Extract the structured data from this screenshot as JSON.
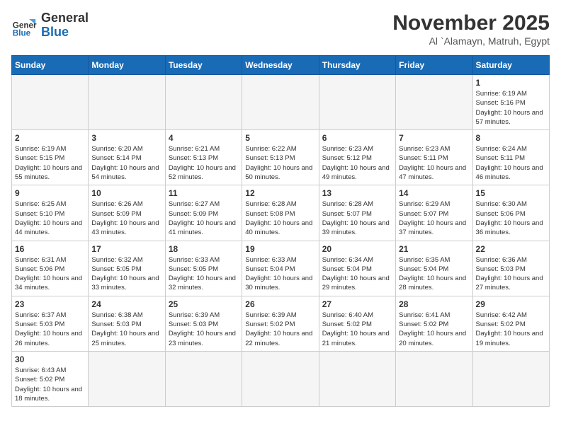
{
  "logo": {
    "text_general": "General",
    "text_blue": "Blue"
  },
  "header": {
    "month_year": "November 2025",
    "location": "Al `Alamayn, Matruh, Egypt"
  },
  "weekdays": [
    "Sunday",
    "Monday",
    "Tuesday",
    "Wednesday",
    "Thursday",
    "Friday",
    "Saturday"
  ],
  "days": {
    "d1": {
      "num": "1",
      "sunrise": "6:19 AM",
      "sunset": "5:16 PM",
      "daylight": "10 hours and 57 minutes."
    },
    "d2": {
      "num": "2",
      "sunrise": "6:19 AM",
      "sunset": "5:15 PM",
      "daylight": "10 hours and 55 minutes."
    },
    "d3": {
      "num": "3",
      "sunrise": "6:20 AM",
      "sunset": "5:14 PM",
      "daylight": "10 hours and 54 minutes."
    },
    "d4": {
      "num": "4",
      "sunrise": "6:21 AM",
      "sunset": "5:13 PM",
      "daylight": "10 hours and 52 minutes."
    },
    "d5": {
      "num": "5",
      "sunrise": "6:22 AM",
      "sunset": "5:13 PM",
      "daylight": "10 hours and 50 minutes."
    },
    "d6": {
      "num": "6",
      "sunrise": "6:23 AM",
      "sunset": "5:12 PM",
      "daylight": "10 hours and 49 minutes."
    },
    "d7": {
      "num": "7",
      "sunrise": "6:23 AM",
      "sunset": "5:11 PM",
      "daylight": "10 hours and 47 minutes."
    },
    "d8": {
      "num": "8",
      "sunrise": "6:24 AM",
      "sunset": "5:11 PM",
      "daylight": "10 hours and 46 minutes."
    },
    "d9": {
      "num": "9",
      "sunrise": "6:25 AM",
      "sunset": "5:10 PM",
      "daylight": "10 hours and 44 minutes."
    },
    "d10": {
      "num": "10",
      "sunrise": "6:26 AM",
      "sunset": "5:09 PM",
      "daylight": "10 hours and 43 minutes."
    },
    "d11": {
      "num": "11",
      "sunrise": "6:27 AM",
      "sunset": "5:09 PM",
      "daylight": "10 hours and 41 minutes."
    },
    "d12": {
      "num": "12",
      "sunrise": "6:28 AM",
      "sunset": "5:08 PM",
      "daylight": "10 hours and 40 minutes."
    },
    "d13": {
      "num": "13",
      "sunrise": "6:28 AM",
      "sunset": "5:07 PM",
      "daylight": "10 hours and 39 minutes."
    },
    "d14": {
      "num": "14",
      "sunrise": "6:29 AM",
      "sunset": "5:07 PM",
      "daylight": "10 hours and 37 minutes."
    },
    "d15": {
      "num": "15",
      "sunrise": "6:30 AM",
      "sunset": "5:06 PM",
      "daylight": "10 hours and 36 minutes."
    },
    "d16": {
      "num": "16",
      "sunrise": "6:31 AM",
      "sunset": "5:06 PM",
      "daylight": "10 hours and 34 minutes."
    },
    "d17": {
      "num": "17",
      "sunrise": "6:32 AM",
      "sunset": "5:05 PM",
      "daylight": "10 hours and 33 minutes."
    },
    "d18": {
      "num": "18",
      "sunrise": "6:33 AM",
      "sunset": "5:05 PM",
      "daylight": "10 hours and 32 minutes."
    },
    "d19": {
      "num": "19",
      "sunrise": "6:33 AM",
      "sunset": "5:04 PM",
      "daylight": "10 hours and 30 minutes."
    },
    "d20": {
      "num": "20",
      "sunrise": "6:34 AM",
      "sunset": "5:04 PM",
      "daylight": "10 hours and 29 minutes."
    },
    "d21": {
      "num": "21",
      "sunrise": "6:35 AM",
      "sunset": "5:04 PM",
      "daylight": "10 hours and 28 minutes."
    },
    "d22": {
      "num": "22",
      "sunrise": "6:36 AM",
      "sunset": "5:03 PM",
      "daylight": "10 hours and 27 minutes."
    },
    "d23": {
      "num": "23",
      "sunrise": "6:37 AM",
      "sunset": "5:03 PM",
      "daylight": "10 hours and 26 minutes."
    },
    "d24": {
      "num": "24",
      "sunrise": "6:38 AM",
      "sunset": "5:03 PM",
      "daylight": "10 hours and 25 minutes."
    },
    "d25": {
      "num": "25",
      "sunrise": "6:39 AM",
      "sunset": "5:03 PM",
      "daylight": "10 hours and 23 minutes."
    },
    "d26": {
      "num": "26",
      "sunrise": "6:39 AM",
      "sunset": "5:02 PM",
      "daylight": "10 hours and 22 minutes."
    },
    "d27": {
      "num": "27",
      "sunrise": "6:40 AM",
      "sunset": "5:02 PM",
      "daylight": "10 hours and 21 minutes."
    },
    "d28": {
      "num": "28",
      "sunrise": "6:41 AM",
      "sunset": "5:02 PM",
      "daylight": "10 hours and 20 minutes."
    },
    "d29": {
      "num": "29",
      "sunrise": "6:42 AM",
      "sunset": "5:02 PM",
      "daylight": "10 hours and 19 minutes."
    },
    "d30": {
      "num": "30",
      "sunrise": "6:43 AM",
      "sunset": "5:02 PM",
      "daylight": "10 hours and 18 minutes."
    }
  }
}
